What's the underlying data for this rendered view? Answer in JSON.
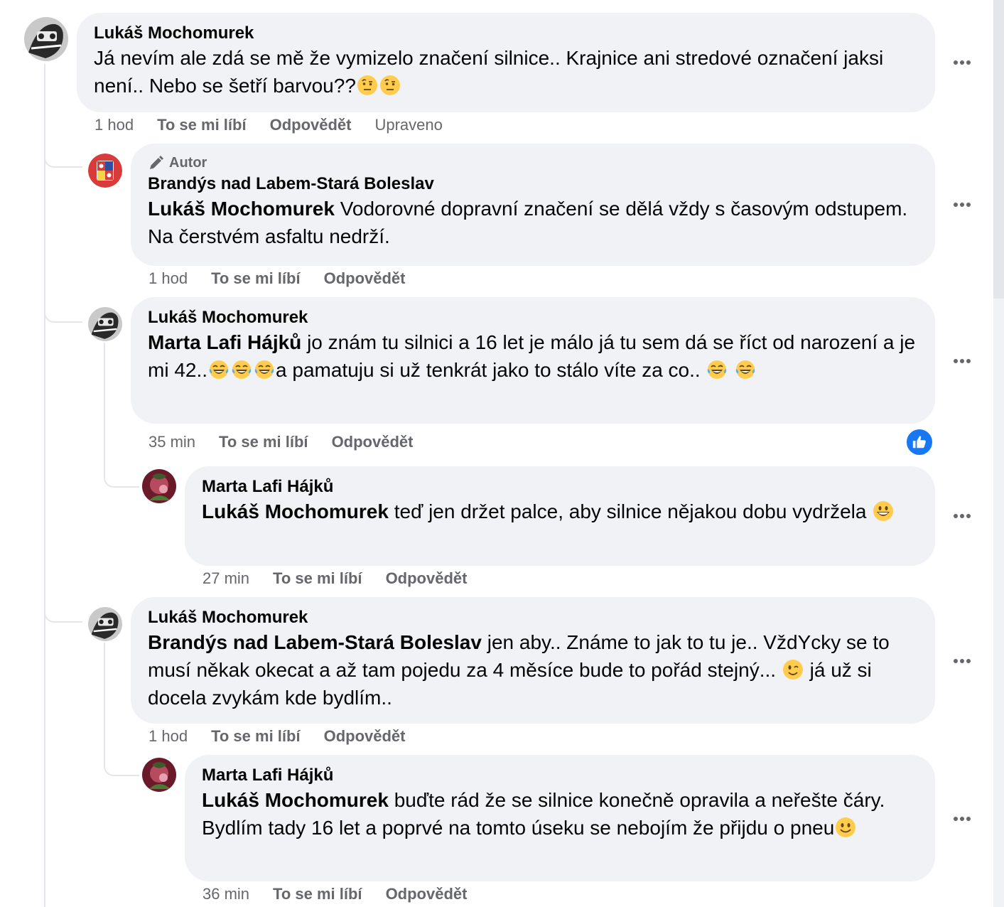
{
  "actions": {
    "like": "To se mi líbí",
    "reply": "Odpovědět",
    "edited": "Upraveno"
  },
  "comments": [
    {
      "author": "Lukáš Mochomurek",
      "text": "Já nevím ale zdá se mě že vymizelo značení silnice.. Krajnice ani stredové označení jaksi není.. Nebo se šetří barvou??",
      "time": "1 hod"
    },
    {
      "badge": "Autor",
      "author": "Brandýs nad Labem-Stará Boleslav",
      "mention": "Lukáš Mochomurek",
      "text": "Vodorovné dopravní značení se dělá vždy s časovým odstupem. Na čerstvém asfaltu nedrží.",
      "time": "1 hod"
    },
    {
      "author": "Lukáš Mochomurek",
      "mention": "Marta Lafi Hájků",
      "text_a": "jo znám tu silnici a 16 let je málo já tu sem dá se říct od narození a je mi 42..",
      "text_b": "a pamatuju si už tenkrát jako to stálo víte za co..",
      "time": "35 min"
    },
    {
      "author": "Marta Lafi Hájků",
      "mention": "Lukáš Mochomurek",
      "text": "teď jen držet palce, aby silnice nějakou dobu vydržela",
      "time": "27 min"
    },
    {
      "author": "Lukáš Mochomurek",
      "mention": "Brandýs nad Labem-Stará Boleslav",
      "text_a": "jen aby.. Známe to jak to tu je.. VždYcky se to musí někak okecat a až tam pojedu za 4 měsíce bude to pořád stejný...",
      "text_b": "já už si docela zvykám kde bydlím..",
      "time": "1 hod"
    },
    {
      "author": "Marta Lafi Hájků",
      "mention": "Lukáš Mochomurek",
      "text": "buďte rád že se silnice konečně opravila a neřešte čáry. Bydlím tady 16 let a poprvé na tomto úseku se nebojím že přijdu o pneu",
      "time": "36 min"
    }
  ],
  "colors": {
    "bubble": "#f0f2f5",
    "meta_text": "#65676b",
    "like_blue": "#1877f2",
    "thread_line": "#e4e6eb"
  },
  "icons": {
    "author_badge": "pencil-author-icon",
    "more": "more-options-icon",
    "reaction": "like-reaction-icon"
  }
}
